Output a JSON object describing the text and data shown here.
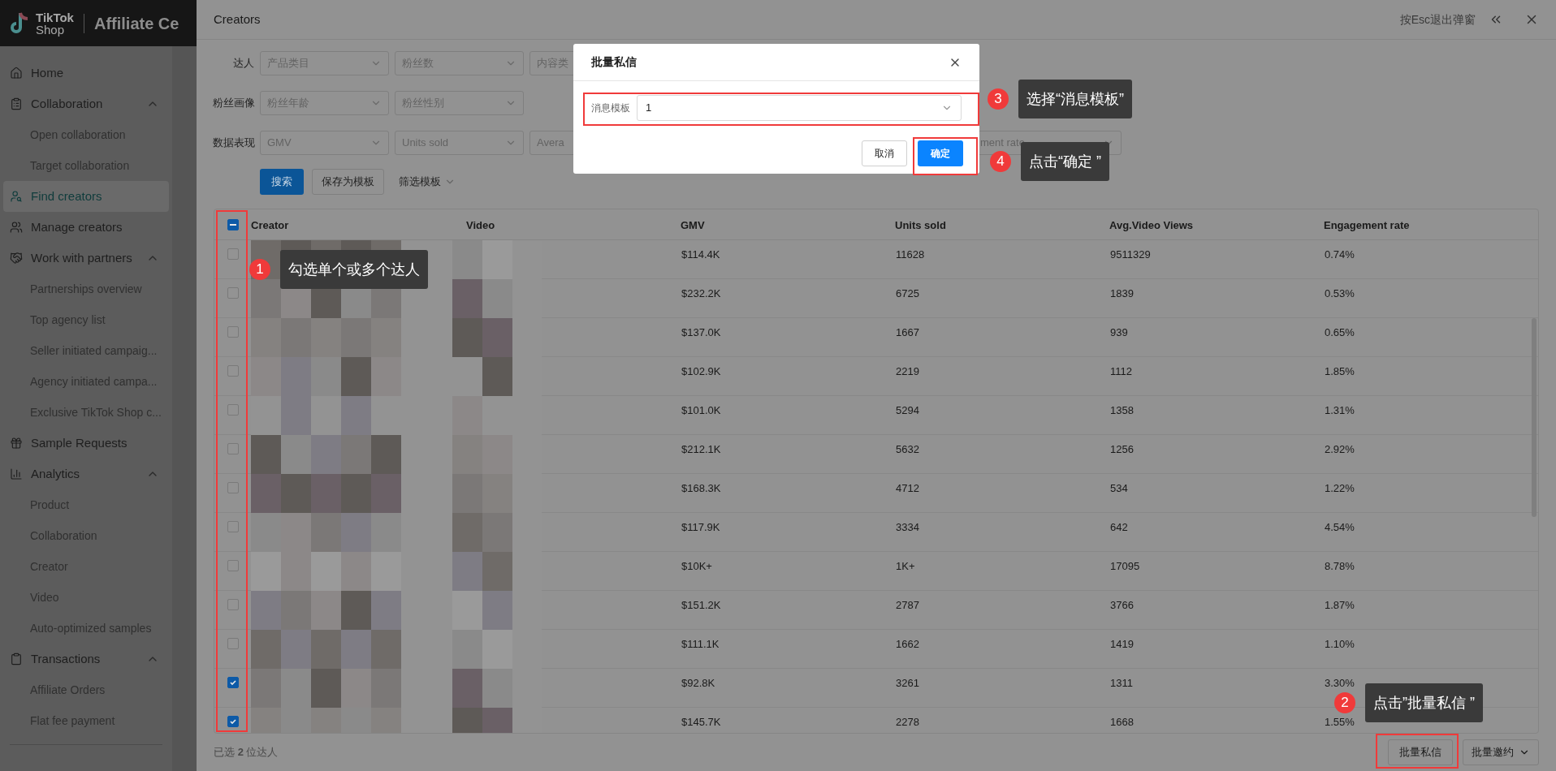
{
  "brand": {
    "logo_text": "TikTok",
    "logo_subtext": "Shop",
    "title": "Affiliate Ce"
  },
  "sidebar": {
    "items": [
      {
        "label": "Home",
        "selected": false
      },
      {
        "label": "Collaboration",
        "expanded": true,
        "selected": false,
        "children": [
          {
            "label": "Open collaboration",
            "selected": false
          },
          {
            "label": "Target collaboration",
            "selected": false
          }
        ]
      },
      {
        "label": "Find creators",
        "selected": true
      },
      {
        "label": "Manage creators",
        "selected": false
      },
      {
        "label": "Work with partners",
        "expanded": true,
        "selected": false,
        "children": [
          {
            "label": "Partnerships overview",
            "selected": false
          },
          {
            "label": "Top agency list",
            "selected": false
          },
          {
            "label": "Seller initiated campaig...",
            "selected": false
          },
          {
            "label": "Agency initiated campa...",
            "selected": false
          },
          {
            "label": "Exclusive TikTok Shop c...",
            "selected": false
          }
        ]
      },
      {
        "label": "Sample Requests",
        "selected": false
      },
      {
        "label": "Analytics",
        "expanded": true,
        "selected": false,
        "children": [
          {
            "label": "Product",
            "selected": false
          },
          {
            "label": "Collaboration",
            "selected": false
          },
          {
            "label": "Creator",
            "selected": false
          },
          {
            "label": "Video",
            "selected": false
          },
          {
            "label": "Auto-optimized samples",
            "selected": false
          }
        ]
      },
      {
        "label": "Transactions",
        "expanded": true,
        "selected": false,
        "children": [
          {
            "label": "Affiliate Orders",
            "selected": false
          },
          {
            "label": "Flat fee payment",
            "selected": false
          }
        ]
      }
    ]
  },
  "drawer": {
    "title": "Creators",
    "esc_hint": "按Esc退出弹窗"
  },
  "filters": [
    {
      "label": "达人",
      "selects": [
        {
          "placeholder": "产品类目"
        },
        {
          "placeholder": "粉丝数"
        },
        {
          "placeholder": "内容类"
        }
      ]
    },
    {
      "label": "粉丝画像",
      "selects": [
        {
          "placeholder": "粉丝年龄"
        },
        {
          "placeholder": "粉丝性别"
        }
      ]
    },
    {
      "label": "数据表现",
      "selects": [
        {
          "placeholder": "GMV"
        },
        {
          "placeholder": "Units sold"
        },
        {
          "placeholder": "Avera"
        },
        {
          "placeholder": "ment rate"
        }
      ]
    }
  ],
  "filter_actions": [
    {
      "label": "搜索",
      "kind": "primary"
    },
    {
      "label": "保存为模板",
      "kind": "secondary"
    },
    {
      "label": "筛选模板",
      "kind": "dropdown"
    }
  ],
  "table": {
    "select_all": {
      "indeterminate": true
    },
    "columns": [
      "Creator",
      "Video",
      "GMV",
      "Units sold",
      "Avg.Video Views",
      "Engagement rate"
    ],
    "rows": [
      {
        "selected": false,
        "gmv": "$114.4K",
        "units_sold": "11628",
        "avg_video_views": "9511329",
        "engagement_rate": "0.74%"
      },
      {
        "selected": false,
        "gmv": "$232.2K",
        "units_sold": "6725",
        "avg_video_views": "1839",
        "engagement_rate": "0.53%"
      },
      {
        "selected": false,
        "gmv": "$137.0K",
        "units_sold": "1667",
        "avg_video_views": "939",
        "engagement_rate": "0.65%"
      },
      {
        "selected": false,
        "gmv": "$102.9K",
        "units_sold": "2219",
        "avg_video_views": "1112",
        "engagement_rate": "1.85%"
      },
      {
        "selected": false,
        "gmv": "$101.0K",
        "units_sold": "5294",
        "avg_video_views": "1358",
        "engagement_rate": "1.31%"
      },
      {
        "selected": false,
        "gmv": "$212.1K",
        "units_sold": "5632",
        "avg_video_views": "1256",
        "engagement_rate": "2.92%"
      },
      {
        "selected": false,
        "gmv": "$168.3K",
        "units_sold": "4712",
        "avg_video_views": "534",
        "engagement_rate": "1.22%"
      },
      {
        "selected": false,
        "gmv": "$117.9K",
        "units_sold": "3334",
        "avg_video_views": "642",
        "engagement_rate": "4.54%"
      },
      {
        "selected": false,
        "gmv": "$10K+",
        "units_sold": "1K+",
        "avg_video_views": "17095",
        "engagement_rate": "8.78%"
      },
      {
        "selected": false,
        "gmv": "$151.2K",
        "units_sold": "2787",
        "avg_video_views": "3766",
        "engagement_rate": "1.87%"
      },
      {
        "selected": false,
        "gmv": "$111.1K",
        "units_sold": "1662",
        "avg_video_views": "1419",
        "engagement_rate": "1.10%"
      },
      {
        "selected": true,
        "gmv": "$92.8K",
        "units_sold": "3261",
        "avg_video_views": "1311",
        "engagement_rate": "3.30%"
      },
      {
        "selected": true,
        "gmv": "$145.7K",
        "units_sold": "2278",
        "avg_video_views": "1668",
        "engagement_rate": "1.55%"
      }
    ]
  },
  "footer": {
    "selection_summary": "已选 **2** 位达人",
    "buttons": [
      {
        "label": "批量私信",
        "kind": "button"
      },
      {
        "label": "批量邀约",
        "kind": "dropdown"
      }
    ]
  },
  "modal": {
    "title": "批量私信",
    "field_label": "消息模板",
    "field_value": "1",
    "buttons": [
      {
        "label": "取消",
        "kind": "secondary"
      },
      {
        "label": "确定",
        "kind": "primary"
      }
    ]
  },
  "annotations": [
    {
      "number": "1",
      "text": "勾选单个或多个达人"
    },
    {
      "number": "2",
      "text": "点击”批量私信 ”"
    },
    {
      "number": "3",
      "text": "选择“消息模板”"
    },
    {
      "number": "4",
      "text": "点击“确定 ”"
    }
  ]
}
